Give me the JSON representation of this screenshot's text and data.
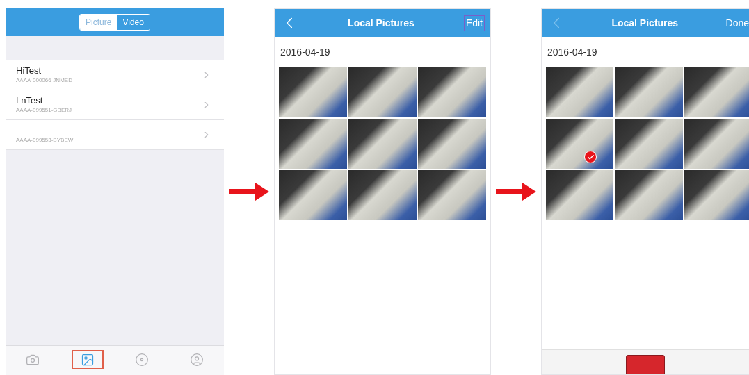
{
  "screens": [
    {
      "kind": "devices",
      "segments": [
        {
          "label": "Picture",
          "selected": true
        },
        {
          "label": "Video",
          "selected": false
        }
      ],
      "devices": [
        {
          "name": "HiTest",
          "id": "AAAA-000066-JNMED"
        },
        {
          "name": "LnTest",
          "id": "AAAA-099551-GBERJ"
        },
        {
          "id": "AAAA-099553-BYBEW"
        }
      ],
      "tabbar": [
        {
          "selected": false
        },
        {
          "selected": true
        },
        {
          "selected": false
        },
        {
          "selected": false
        }
      ]
    },
    {
      "kind": "gallery",
      "title": "Local Pictures",
      "back_disabled": false,
      "action": "Edit",
      "action_outlined": true,
      "date": "2016-04-19",
      "photos": [
        {
          "selected": false
        },
        {
          "selected": false
        },
        {
          "selected": false
        },
        {
          "selected": false
        },
        {
          "selected": false
        },
        {
          "selected": false
        },
        {
          "selected": false
        },
        {
          "selected": false
        },
        {
          "selected": false
        }
      ]
    },
    {
      "kind": "gallery",
      "title": "Local Pictures",
      "back_disabled": true,
      "action": "Done",
      "action_outlined": false,
      "date": "2016-04-19",
      "photos": [
        {
          "selected": false
        },
        {
          "selected": false
        },
        {
          "selected": false
        },
        {
          "selected": true
        },
        {
          "selected": false
        },
        {
          "selected": false
        },
        {
          "selected": false
        },
        {
          "selected": false
        },
        {
          "selected": false
        }
      ],
      "delete_button": true
    }
  ]
}
